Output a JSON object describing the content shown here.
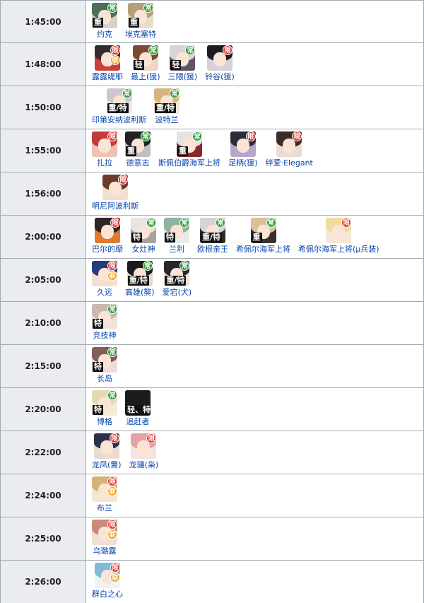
{
  "colors": {
    "limited_badge": "#e53535",
    "standard_badge": "#2e9c3a",
    "collab_badge": "#f0a41f",
    "link": "#0645ad",
    "time_cell_bg": "#eaecf0",
    "border": "#a2a9b1"
  },
  "rows": [
    {
      "time": "1:45:00",
      "ships": [
        {
          "name": "约克",
          "badges": [
            "常"
          ],
          "type": "重",
          "palette": [
            "#4a6f56",
            "#d8d1c4"
          ]
        },
        {
          "name": "埃克塞特",
          "badges": [
            "常"
          ],
          "type": "重",
          "palette": [
            "#b59e7b",
            "#e9ddc8"
          ]
        }
      ]
    },
    {
      "time": "1:48:00",
      "ships": [
        {
          "name": "露露缇耶",
          "badges": [
            "限",
            "联"
          ],
          "type": "",
          "palette": [
            "#3a2b2b",
            "#c8413b"
          ]
        },
        {
          "name": "最上(猨)",
          "badges": [
            "常"
          ],
          "type": "轻",
          "palette": [
            "#7b4a33",
            "#efd6c6"
          ]
        },
        {
          "name": "三隈(猨)",
          "badges": [
            "常"
          ],
          "type": "轻",
          "palette": [
            "#d9d4d8",
            "#5f5566"
          ]
        },
        {
          "name": "铃谷(猨)",
          "badges": [
            "限"
          ],
          "type": "",
          "palette": [
            "#1d1b22",
            "#d6d2d8"
          ]
        }
      ]
    },
    {
      "time": "1:50:00",
      "ships": [
        {
          "name": "印第安纳波利斯",
          "badges": [
            "常"
          ],
          "type": "重/特",
          "palette": [
            "#ccc6ce",
            "#efe6ea"
          ]
        },
        {
          "name": "波特兰",
          "badges": [
            "常"
          ],
          "type": "重/特",
          "palette": [
            "#d8b57f",
            "#f1e6d0"
          ]
        }
      ]
    },
    {
      "time": "1:55:00",
      "ships": [
        {
          "name": "扎拉",
          "badges": [
            "限"
          ],
          "type": "",
          "palette": [
            "#c43b3b",
            "#f0c0b0"
          ]
        },
        {
          "name": "德意志",
          "badges": [
            "常"
          ],
          "type": "重",
          "palette": [
            "#222222",
            "#bfbfbf"
          ]
        },
        {
          "name": "斯佩伯爵海军上将",
          "badges": [
            "常"
          ],
          "type": "重",
          "palette": [
            "#e7e2e4",
            "#8a2630"
          ]
        },
        {
          "name": "足柄(猨)",
          "badges": [
            "限"
          ],
          "type": "",
          "palette": [
            "#2c2a3c",
            "#b7a6c9"
          ]
        },
        {
          "name": "绊爱·Elegant",
          "badges": [
            "限"
          ],
          "type": "",
          "palette": [
            "#3b2c27",
            "#eddcd1"
          ]
        }
      ]
    },
    {
      "time": "1:56:00",
      "ships": [
        {
          "name": "明尼阿波利斯",
          "badges": [
            "限"
          ],
          "type": "",
          "palette": [
            "#6b3b2a",
            "#f3dfcf"
          ]
        }
      ]
    },
    {
      "time": "2:00:00",
      "ships": [
        {
          "name": "巴尔的摩",
          "badges": [
            "限"
          ],
          "type": "",
          "palette": [
            "#2f2428",
            "#e07a2e"
          ]
        },
        {
          "name": "女灶神",
          "badges": [
            "常"
          ],
          "type": "特",
          "palette": [
            "#e9e4e1",
            "#a9a19c"
          ]
        },
        {
          "name": "兰利",
          "badges": [
            "常"
          ],
          "type": "特",
          "palette": [
            "#8fb3a0",
            "#e8ede7"
          ]
        },
        {
          "name": "欧根亲王",
          "badges": [
            "常"
          ],
          "type": "重/特",
          "palette": [
            "#d6d3d6",
            "#30292b"
          ]
        },
        {
          "name": "希佩尔海军上将",
          "badges": [
            "常"
          ],
          "type": "重",
          "palette": [
            "#d9c29a",
            "#3a2f2a"
          ]
        },
        {
          "name": "希佩尔海军上将(μ兵装)",
          "badges": [
            "限"
          ],
          "type": "",
          "palette": [
            "#f0dc9c",
            "#f6e8d8"
          ]
        }
      ]
    },
    {
      "time": "2:05:00",
      "ships": [
        {
          "name": "久远",
          "badges": [
            "限",
            "联"
          ],
          "type": "",
          "palette": [
            "#243d7a",
            "#f3ded2"
          ]
        },
        {
          "name": "高雄(獒)",
          "badges": [
            "常"
          ],
          "type": "重/特",
          "palette": [
            "#1b1b1f",
            "#e6d9d3"
          ]
        },
        {
          "name": "爱宕(犬)",
          "badges": [
            "常"
          ],
          "type": "重/特",
          "palette": [
            "#26262b",
            "#f0e2da"
          ]
        }
      ]
    },
    {
      "time": "2:10:00",
      "ships": [
        {
          "name": "竞技神",
          "badges": [
            "常"
          ],
          "type": "特",
          "palette": [
            "#c9b8b0",
            "#f0e3dc"
          ]
        }
      ]
    },
    {
      "time": "2:15:00",
      "ships": [
        {
          "name": "长岛",
          "badges": [
            "常"
          ],
          "type": "特",
          "palette": [
            "#7f5f58",
            "#eddbd5"
          ]
        }
      ]
    },
    {
      "time": "2:20:00",
      "ships": [
        {
          "name": "博格",
          "badges": [
            "常"
          ],
          "type": "特",
          "palette": [
            "#e5d8b2",
            "#f5ecd8"
          ]
        },
        {
          "name": "追赶者",
          "badges": [],
          "type": "轻、特",
          "palette": [
            "#1b1b1b",
            "#1b1b1b"
          ]
        }
      ]
    },
    {
      "time": "2:22:00",
      "ships": [
        {
          "name": "龙凤(鸗)",
          "badges": [
            "限"
          ],
          "type": "",
          "palette": [
            "#2b2f4a",
            "#e7dccf"
          ]
        },
        {
          "name": "龙骧(枭)",
          "badges": [
            "限"
          ],
          "type": "",
          "palette": [
            "#e4a3a6",
            "#f6e3e2"
          ]
        }
      ]
    },
    {
      "time": "2:24:00",
      "ships": [
        {
          "name": "布兰",
          "badges": [
            "限",
            "联"
          ],
          "type": "",
          "palette": [
            "#d4b378",
            "#f4e6d4"
          ]
        }
      ]
    },
    {
      "time": "2:25:00",
      "ships": [
        {
          "name": "乌璐露",
          "badges": [
            "限",
            "联"
          ],
          "type": "",
          "palette": [
            "#c98b79",
            "#f2dfd8"
          ]
        }
      ]
    },
    {
      "time": "2:26:00",
      "ships": [
        {
          "name": "群白之心",
          "badges": [
            "限",
            "联"
          ],
          "type": "",
          "palette": [
            "#7fbad6",
            "#eef4f6"
          ]
        }
      ]
    }
  ]
}
